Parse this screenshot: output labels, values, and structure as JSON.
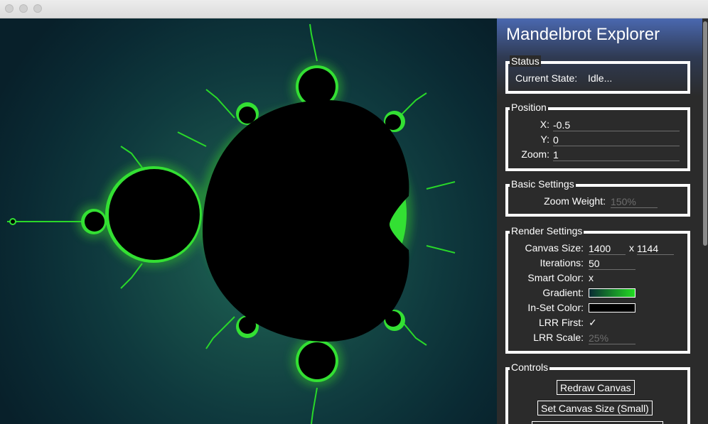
{
  "window": {
    "close_icon": "circle",
    "minimize_icon": "circle",
    "zoom_icon": "circle"
  },
  "app": {
    "title": "Mandelbrot Explorer"
  },
  "status": {
    "group_title": "Status",
    "state_label": "Current State:",
    "state_value": "Idle..."
  },
  "position": {
    "group_title": "Position",
    "x_label": "X:",
    "x_value": "-0.5",
    "y_label": "Y:",
    "y_value": "0",
    "zoom_label": "Zoom:",
    "zoom_value": "1"
  },
  "basic_settings": {
    "group_title": "Basic Settings",
    "zoom_weight_label": "Zoom Weight:",
    "zoom_weight_value": "150%"
  },
  "render_settings": {
    "group_title": "Render Settings",
    "canvas_size_label": "Canvas Size:",
    "canvas_width": "1400",
    "canvas_sep": "x",
    "canvas_height": "1144",
    "iterations_label": "Iterations:",
    "iterations_value": "50",
    "smart_color_label": "Smart Color:",
    "smart_color_value": "x",
    "gradient_label": "Gradient:",
    "gradient_start": "#0a2a33",
    "gradient_end": "#22dd22",
    "inset_color_label": "In-Set Color:",
    "inset_color": "#000000",
    "lrr_first_label": "LRR First:",
    "lrr_first_value": "✓",
    "lrr_scale_label": "LRR Scale:",
    "lrr_scale_value": "25%"
  },
  "controls": {
    "group_title": "Controls",
    "redraw_label": "Redraw Canvas",
    "set_small_label": "Set Canvas Size (Small)"
  },
  "colors": {
    "accent_fractal": "#22dd22",
    "panel_bg": "#2b2b2b",
    "title_bar_blue": "#4a68b0"
  }
}
